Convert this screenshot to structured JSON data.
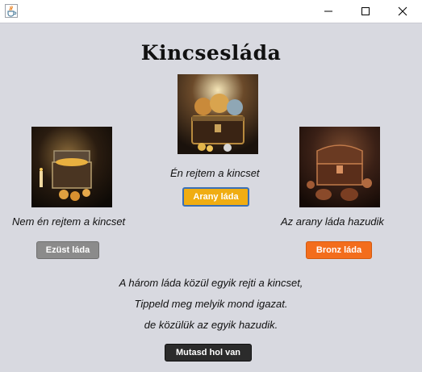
{
  "window": {
    "app_icon": "java-cup-icon",
    "controls": [
      "minimize-icon",
      "maximize-icon",
      "close-icon"
    ]
  },
  "main": {
    "title": "Kincsesláda",
    "chests": [
      {
        "image": "silver-treasure-chest-image",
        "statement": "Nem én rejtem a kincset",
        "button": "Ezüst láda",
        "color": "#8b8b8b"
      },
      {
        "image": "gold-treasure-chest-image",
        "statement": "Én rejtem a kincset",
        "button": "Arany láda",
        "color": "#f0ad12"
      },
      {
        "image": "bronze-treasure-chest-image",
        "statement": "Az arany láda hazudik",
        "button": "Bronz láda",
        "color": "#f36d1c"
      }
    ],
    "instructions": [
      "A három láda közül egyik rejti a kincset,",
      "Tippeld meg melyik mond igazat.",
      "de közülük az egyik hazudik."
    ],
    "reveal_button": "Mutasd hol van"
  },
  "colors": {
    "background": "#d8d9e0",
    "gold": "#f0ad12",
    "silver": "#8b8b8b",
    "bronze": "#f36d1c",
    "dark": "#2b2b2b"
  }
}
